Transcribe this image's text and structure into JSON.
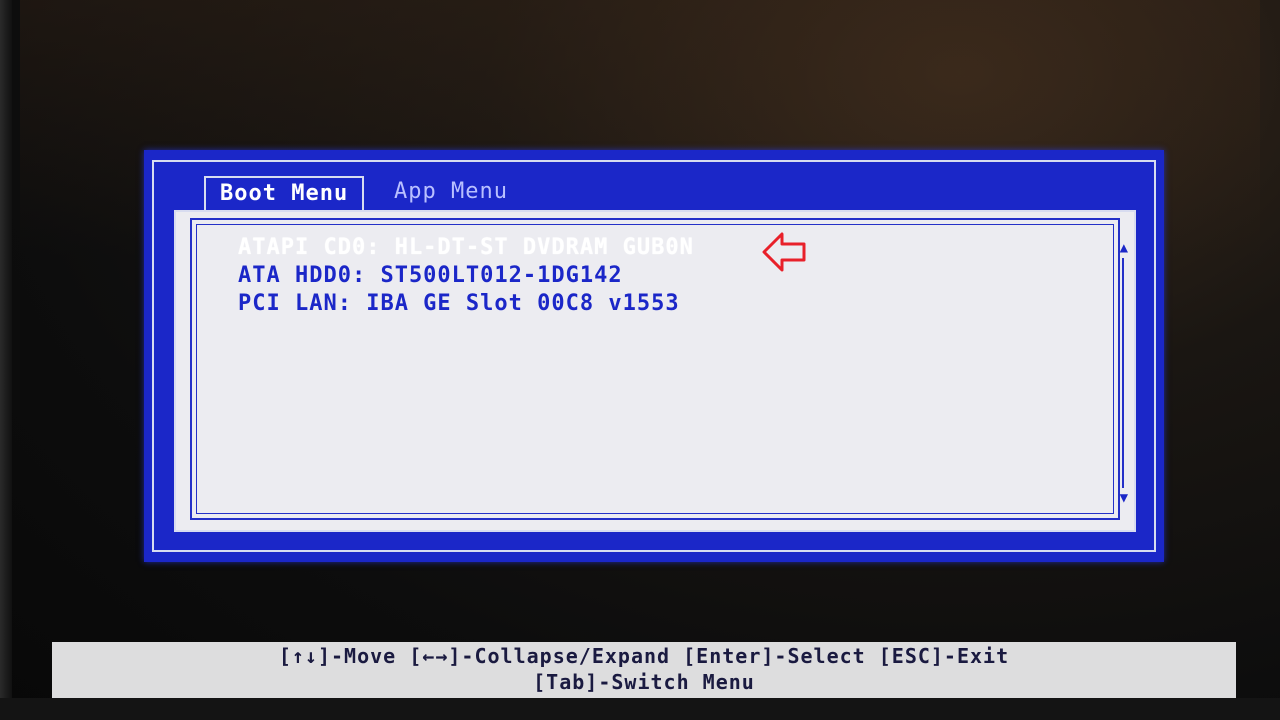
{
  "tabs": [
    {
      "label": "Boot Menu",
      "active": true
    },
    {
      "label": "App Menu",
      "active": false
    }
  ],
  "boot_items": [
    {
      "label": "ATAPI CD0: HL-DT-ST DVDRAM GUB0N",
      "selected": true
    },
    {
      "label": "ATA HDD0: ST500LT012-1DG142",
      "selected": false
    },
    {
      "label": "PCI LAN: IBA GE Slot 00C8 v1553",
      "selected": false
    }
  ],
  "scrollbar": {
    "up_glyph": "▲",
    "down_glyph": "▼"
  },
  "footer": {
    "line1": "[↑↓]-Move [←→]-Collapse/Expand [Enter]-Select [ESC]-Exit",
    "line2": "[Tab]-Switch Menu"
  },
  "colors": {
    "dialog_blue": "#1b27c8",
    "panel_bg": "#ececf1",
    "highlight_white": "#ffffff",
    "annotation_red": "#e8202a"
  },
  "icons": {
    "annotation": "red-arrow-left-icon"
  }
}
